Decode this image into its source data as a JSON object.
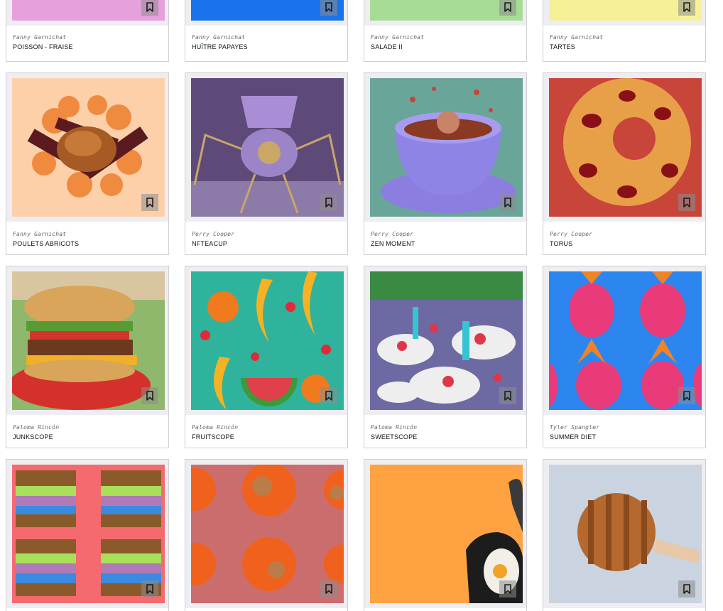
{
  "cards": [
    {
      "author": "Fanny Garnichat",
      "title": "POISSON - FRAISE",
      "bg": "#e6a0dc"
    },
    {
      "author": "Fanny Garnichat",
      "title": "HUÎTRE PAPAYES",
      "bg": "#1a73ea"
    },
    {
      "author": "Fanny Garnichat",
      "title": "SALADE II",
      "bg": "#a8dc96"
    },
    {
      "author": "Fanny Garnichat",
      "title": "TARTES",
      "bg": "#f6f196"
    },
    {
      "author": "Fanny Garnichat",
      "title": "POULETS ABRICOTS",
      "bg": "#fdd0aa"
    },
    {
      "author": "Perry Cooper",
      "title": "NFTEACUP",
      "bg": "#5e4a78"
    },
    {
      "author": "Perry Cooper",
      "title": "ZEN MOMENT",
      "bg": "#6aa59a"
    },
    {
      "author": "Perry Cooper",
      "title": "TORUS",
      "bg": "#c8453a"
    },
    {
      "author": "Paloma Rincón",
      "title": "JUNKSCOPE",
      "bg": "#8fb86c"
    },
    {
      "author": "Paloma Rincón",
      "title": "FRUITSCOPE",
      "bg": "#2fb39c"
    },
    {
      "author": "Paloma Rincón",
      "title": "SWEETSCOPE",
      "bg": "#6d6aa3"
    },
    {
      "author": "Tyler Spangler",
      "title": "SUMMER DIET",
      "bg": "#2d86f0"
    },
    {
      "author": "",
      "title": "",
      "bg": "#f56a6e"
    },
    {
      "author": "",
      "title": "",
      "bg": "#cc6d6d"
    },
    {
      "author": "",
      "title": "",
      "bg": "#ffa242"
    },
    {
      "author": "",
      "title": "",
      "bg": "#c9d4e0"
    }
  ],
  "icons": {
    "bookmark": "bookmark-icon"
  }
}
